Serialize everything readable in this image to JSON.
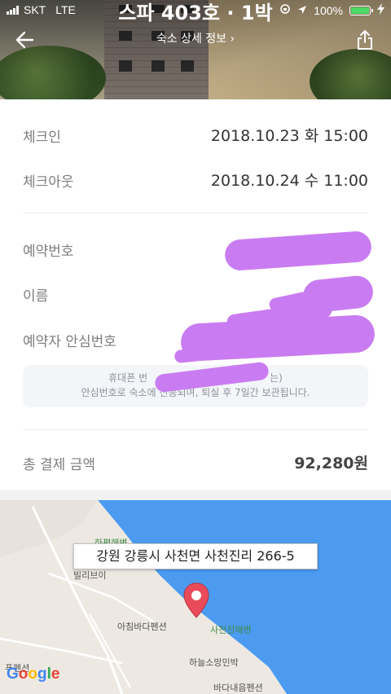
{
  "status_bar": {
    "carrier": "SKT",
    "network": "LTE",
    "battery": "100%",
    "battery_level": 1.0
  },
  "header": {
    "title": "스파 403호 · 1박",
    "subtitle": "숙소 상세 정보 ›"
  },
  "booking": {
    "checkin_label": "체크인",
    "checkin_value": "2018.10.23 화 15:00",
    "checkout_label": "체크아웃",
    "checkout_value": "2018.10.24 수 11:00",
    "reservation_number_label": "예약번호",
    "name_label": "이름",
    "safe_number_label": "예약자 안심번호",
    "notice_line1": "휴대폰 번",
    "notice_line1_end": "는",
    "notice_line2": "안심번호로 숙소에 전송되며, 퇴실 후 7일간 보관됩니다.",
    "total_label": "총 결제 금액",
    "total_value": "92,280원"
  },
  "map": {
    "address": "강원 강릉시 사천면 사천진리 266-5",
    "labels": {
      "hapyeong": "하평해변",
      "villa": "빌리브이",
      "achim": "아침바다펜션",
      "sacheonjin": "사천진해변",
      "haneul": "하늘소망민박",
      "pension_sw": "푸펜션",
      "pension_s": "바다내음펜션"
    },
    "google": "Google"
  },
  "colors": {
    "scribble": "#c97cf1",
    "sea": "#4c9bf1",
    "pin": "#e94b5b"
  }
}
